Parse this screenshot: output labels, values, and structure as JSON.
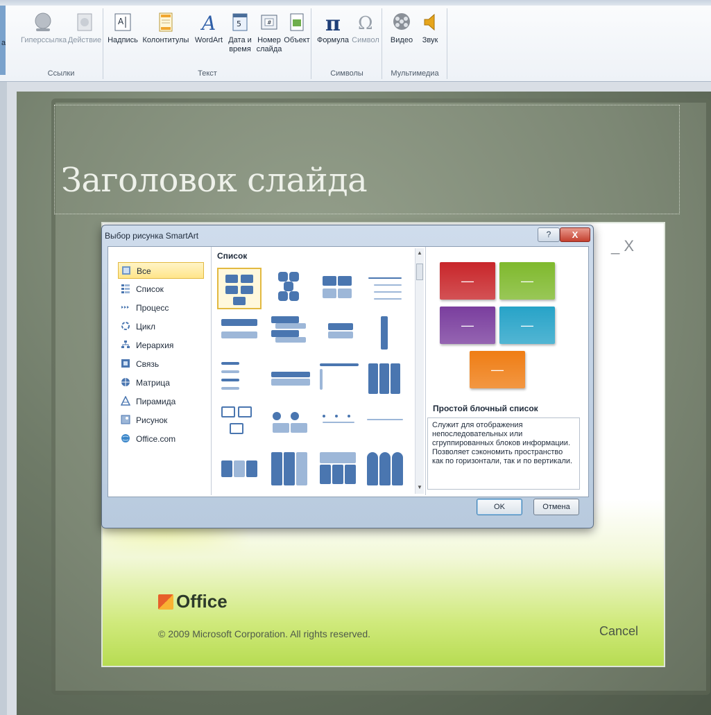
{
  "ribbon": {
    "cut_left_label": "а",
    "groups": [
      {
        "label": "Ссылки",
        "buttons": [
          {
            "label": "Гиперссылка",
            "disabled": true
          },
          {
            "label": "Действие",
            "disabled": true
          }
        ]
      },
      {
        "label": "Текст",
        "buttons": [
          {
            "label": "Надпись"
          },
          {
            "label": "Колонтитулы"
          },
          {
            "label": "WordArt"
          },
          {
            "label": "Дата и время"
          },
          {
            "label": "Номер слайда"
          },
          {
            "label": "Объект"
          }
        ]
      },
      {
        "label": "Символы",
        "buttons": [
          {
            "label": "Формула"
          },
          {
            "label": "Символ",
            "disabled": true
          }
        ]
      },
      {
        "label": "Мультимедиа",
        "buttons": [
          {
            "label": "Видео"
          },
          {
            "label": "Звук"
          }
        ]
      }
    ]
  },
  "slide": {
    "title": "Заголовок слайда"
  },
  "splash": {
    "close_glyph": "_ X",
    "brand": "Office",
    "copyright": "© 2009 Microsoft Corporation.  All rights reserved.",
    "cancel": "Cancel"
  },
  "dialog": {
    "title": "Выбор рисунка SmartArt",
    "help": "?",
    "close": "X",
    "categories": [
      "Все",
      "Список",
      "Процесс",
      "Цикл",
      "Иерархия",
      "Связь",
      "Матрица",
      "Пирамида",
      "Рисунок",
      "Office.com"
    ],
    "selected_category": "Все",
    "gallery_heading": "Список",
    "preview": {
      "name": "Простой блочный список",
      "description": "Служит для отображения непоследовательных или сгруппированных блоков информации. Позволяет сэкономить пространство как по горизонтали, так и по вертикали.",
      "block_glyph": "—",
      "colors": [
        "#c8262a",
        "#7fb92d",
        "#7a3e9e",
        "#27a3c8",
        "#ef7d14"
      ]
    },
    "ok": "OK",
    "cancel": "Отмена"
  }
}
